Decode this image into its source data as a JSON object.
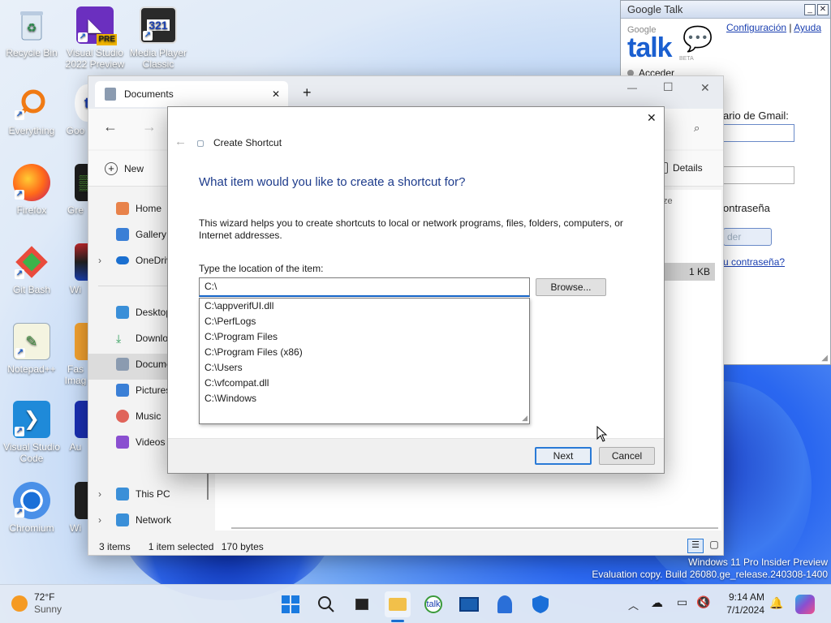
{
  "desktop": {
    "icons": [
      {
        "label": "Recycle Bin",
        "icon": "recycle-bin-icon"
      },
      {
        "label": "Visual Studio 2022 Preview",
        "icon": "visual-studio-icon",
        "badge": "PRE"
      },
      {
        "label": "Media Player Classic",
        "icon": "media-player-icon",
        "badge": "321"
      },
      {
        "label": "Everything",
        "icon": "everything-search-icon"
      },
      {
        "label": "Goo",
        "icon": "google-talk-icon"
      },
      {
        "label": "Firefox",
        "icon": "firefox-icon"
      },
      {
        "label": "Gre",
        "icon": "app-icon"
      },
      {
        "label": "Git Bash",
        "icon": "git-bash-icon"
      },
      {
        "label": "Wi",
        "icon": "app-icon"
      },
      {
        "label": "Notepad++",
        "icon": "notepadpp-icon"
      },
      {
        "label": "Fas Imag",
        "icon": "app-icon"
      },
      {
        "label": "Visual Studio Code",
        "icon": "vscode-icon"
      },
      {
        "label": "Au",
        "icon": "app-icon"
      },
      {
        "label": "Chromium",
        "icon": "chromium-icon"
      },
      {
        "label": "Wi",
        "icon": "app-icon"
      }
    ],
    "watermark_line1": "Windows 11 Pro Insider Preview",
    "watermark_line2": "Evaluation copy. Build 26080.ge_release.240308-1400"
  },
  "gtalk": {
    "title": "Google Talk",
    "close_glyph": "✕",
    "min_glyph": "_",
    "logo_small": "Google",
    "logo_big": "talk",
    "logo_beta": "BETA",
    "link_config": "Configuración",
    "separator": "|",
    "link_help": "Ayuda",
    "status_label": "Acceder",
    "gmail_label": "ario de Gmail:",
    "password_label": "ontraseña",
    "signin_button": "der",
    "forgot_link": "u contraseña?"
  },
  "explorer": {
    "tab_title": "Documents",
    "tab_close": "✕",
    "new_tab": "+",
    "win_min": "—",
    "win_max": "☐",
    "win_close": "✕",
    "new_label": "New",
    "details_label": "Details",
    "size_header": "ze",
    "file_size": "1 KB",
    "nav": [
      {
        "label": "Home",
        "icon": "home-icon",
        "color": "#e8824a"
      },
      {
        "label": "Gallery",
        "icon": "gallery-icon",
        "color": "#3a7fd6"
      },
      {
        "label": "OneDriv",
        "icon": "onedrive-icon",
        "color": "#1a6fd0"
      },
      {
        "label": "Desktop",
        "icon": "desktop-folder-icon",
        "color": "#3a8fd8"
      },
      {
        "label": "Downlo",
        "icon": "downloads-icon",
        "color": "#2f9e5a"
      },
      {
        "label": "Docume",
        "icon": "documents-icon",
        "color": "#8b9bb0"
      },
      {
        "label": "Pictures",
        "icon": "pictures-icon",
        "color": "#3a7fd6"
      },
      {
        "label": "Music",
        "icon": "music-icon",
        "color": "#e0645a"
      },
      {
        "label": "Videos",
        "icon": "videos-icon",
        "color": "#8a4fd0"
      },
      {
        "label": "This PC",
        "icon": "this-pc-icon",
        "color": "#3a8fd8"
      },
      {
        "label": "Network",
        "icon": "network-icon",
        "color": "#3a8fd8"
      }
    ],
    "status_items": "3 items",
    "status_selected": "1 item selected",
    "status_size": "170 bytes"
  },
  "dialog": {
    "title": "Create Shortcut",
    "close_glyph": "✕",
    "heading": "What item would you like to create a shortcut for?",
    "description": "This wizard helps you to create shortcuts to local or network programs, files, folders, computers, or Internet addresses.",
    "location_label": "Type the location of the item:",
    "location_value": "C:\\",
    "browse_label": "Browse...",
    "suggestions": [
      "C:\\appverifUI.dll",
      "C:\\PerfLogs",
      "C:\\Program Files",
      "C:\\Program Files (x86)",
      "C:\\Users",
      "C:\\vfcompat.dll",
      "C:\\Windows"
    ],
    "next_label": "Next",
    "cancel_label": "Cancel"
  },
  "taskbar": {
    "weather_temp": "72°F",
    "weather_desc": "Sunny",
    "time": "9:14 AM",
    "date": "7/1/2024"
  },
  "colors": {
    "accent": "#1464c8",
    "dialog_heading": "#1e3c8c",
    "link": "#1a3fb0"
  }
}
